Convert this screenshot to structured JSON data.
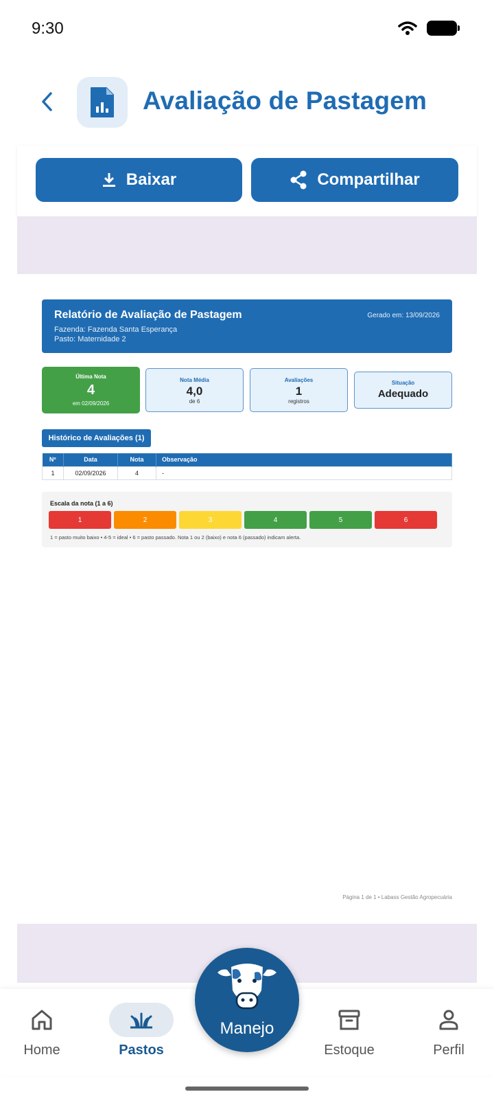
{
  "status_bar": {
    "time": "9:30"
  },
  "header": {
    "title": "Avaliação de Pastagem"
  },
  "actions": {
    "download_label": "Baixar",
    "share_label": "Compartilhar"
  },
  "report": {
    "title": "Relatório de Avaliação de Pastagem",
    "generated": "Gerado em: 13/09/2026",
    "farm": "Fazenda: Fazenda Santa Esperança",
    "pasture": "Pasto: Maternidade 2",
    "stats": {
      "last": {
        "label": "Última Nota",
        "value": "4",
        "sub": "em 02/09/2026"
      },
      "avg": {
        "label": "Nota Média",
        "value": "4,0",
        "sub": "de 6"
      },
      "count": {
        "label": "Avaliações",
        "value": "1",
        "sub": "registros"
      },
      "status": {
        "label": "Situação",
        "value": "Adequado"
      }
    },
    "history_title": "Histórico de Avaliações (1)",
    "table": {
      "headers": [
        "Nº",
        "Data",
        "Nota",
        "Observação"
      ],
      "rows": [
        [
          "1",
          "02/09/2026",
          "4",
          "-"
        ]
      ]
    },
    "scale": {
      "title": "Escala da nota (1 a 6)",
      "cells": [
        {
          "label": "1",
          "color": "#e53935"
        },
        {
          "label": "2",
          "color": "#fb8c00"
        },
        {
          "label": "3",
          "color": "#fdd835"
        },
        {
          "label": "4",
          "color": "#43a047"
        },
        {
          "label": "5",
          "color": "#43a047"
        },
        {
          "label": "6",
          "color": "#e53935"
        }
      ],
      "note": "1 = pasto muito baixo  •  4-5 = ideal  •  6 = pasto passado. Nota 1 ou 2 (baixo) e nota 6 (passado) indicam alerta."
    },
    "footer": "Página 1 de 1  •  Labass Gestão Agropecuária"
  },
  "nav": {
    "home": "Home",
    "pastos": "Pastos",
    "manejo": "Manejo",
    "estoque": "Estoque",
    "perfil": "Perfil"
  },
  "colors": {
    "primary": "#1f6cb3",
    "green": "#43a047",
    "nav_dark": "#1a5a92"
  }
}
